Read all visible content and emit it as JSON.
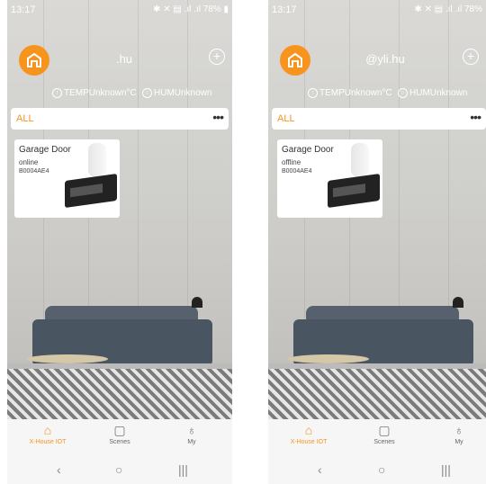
{
  "screens": [
    {
      "status_time": "13:17",
      "status_icons": "✱ ✕ ▤ .ıl .ıl 78% ▮",
      "username": ".hu",
      "temp_label": "TEMPUnknown°C",
      "hum_label": "HUMUnknown",
      "filter_label": "ALL",
      "more_label": "•••",
      "device": {
        "title": "Garage Door",
        "status": "online",
        "code": "B0004AE4"
      },
      "tabs": [
        "X-House IOT",
        "Scenes",
        "My"
      ]
    },
    {
      "status_time": "13:17",
      "status_icons": "✱ ✕ ▤ .ıl .ıl 78%",
      "username": "@yli.hu",
      "temp_label": "TEMPUnknown°C",
      "hum_label": "HUMUnknown",
      "filter_label": "ALL",
      "more_label": "•••",
      "device": {
        "title": "Garage Door",
        "status": "offline",
        "code": "B0004AE4"
      },
      "tabs": [
        "X-House IOT",
        "Scenes",
        "My"
      ]
    }
  ],
  "colors": {
    "accent": "#f7941d",
    "tabbar": "#f6f6f6"
  },
  "icons": [
    "home-icon",
    "scenes-icon",
    "profile-icon",
    "plus-icon",
    "more-icon",
    "thermometer-icon",
    "humidity-icon"
  ]
}
